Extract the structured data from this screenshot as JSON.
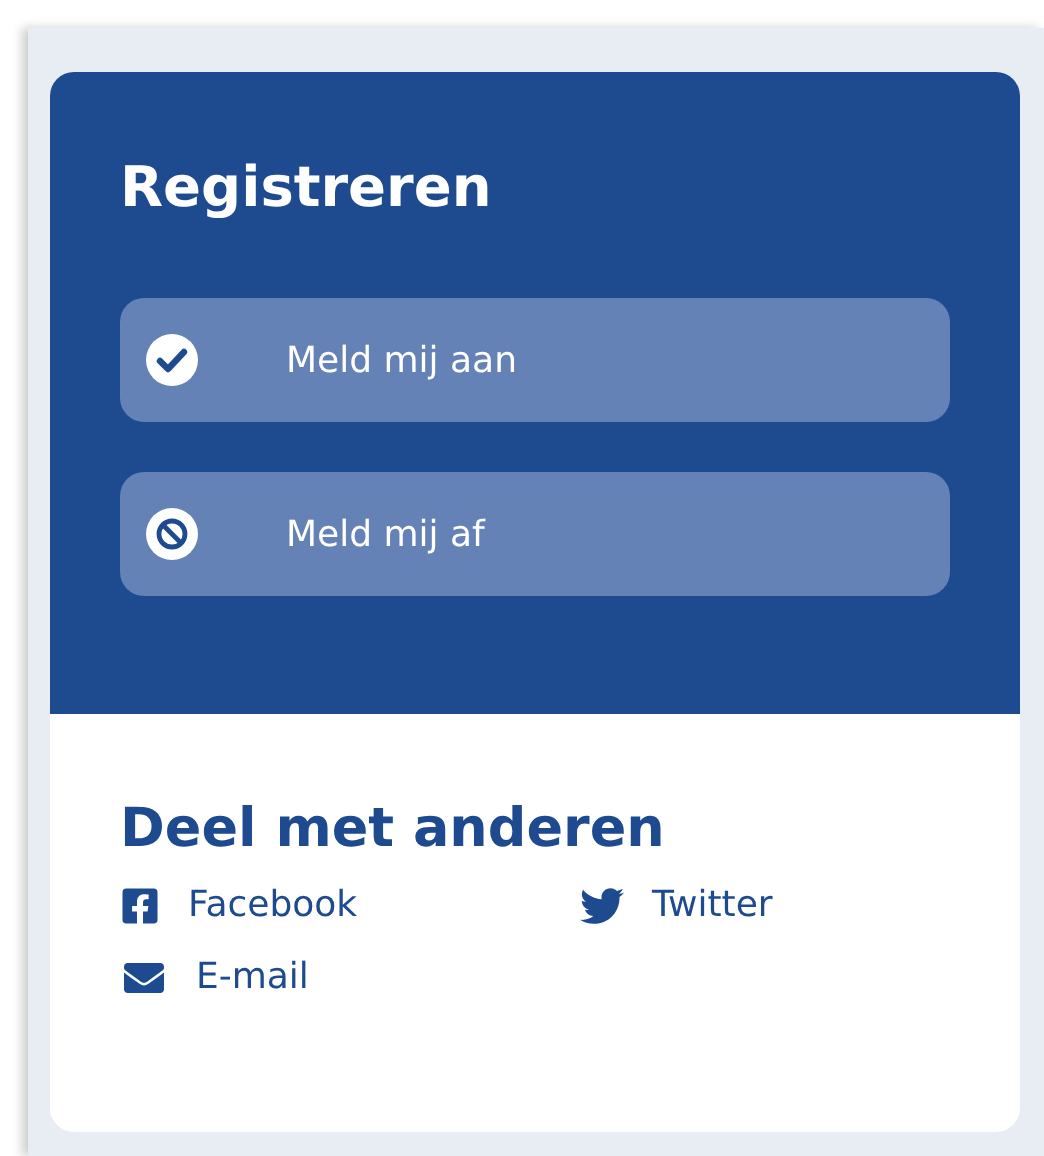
{
  "register": {
    "title": "Registreren",
    "buttons": [
      {
        "kind": "subscribe",
        "label": "Meld mij aan"
      },
      {
        "kind": "unsubscribe",
        "label": "Meld mij af"
      }
    ]
  },
  "share": {
    "title": "Deel met anderen",
    "links": [
      {
        "kind": "facebook",
        "label": "Facebook"
      },
      {
        "kind": "twitter",
        "label": "Twitter"
      },
      {
        "kind": "email",
        "label": "E-mail"
      }
    ]
  }
}
